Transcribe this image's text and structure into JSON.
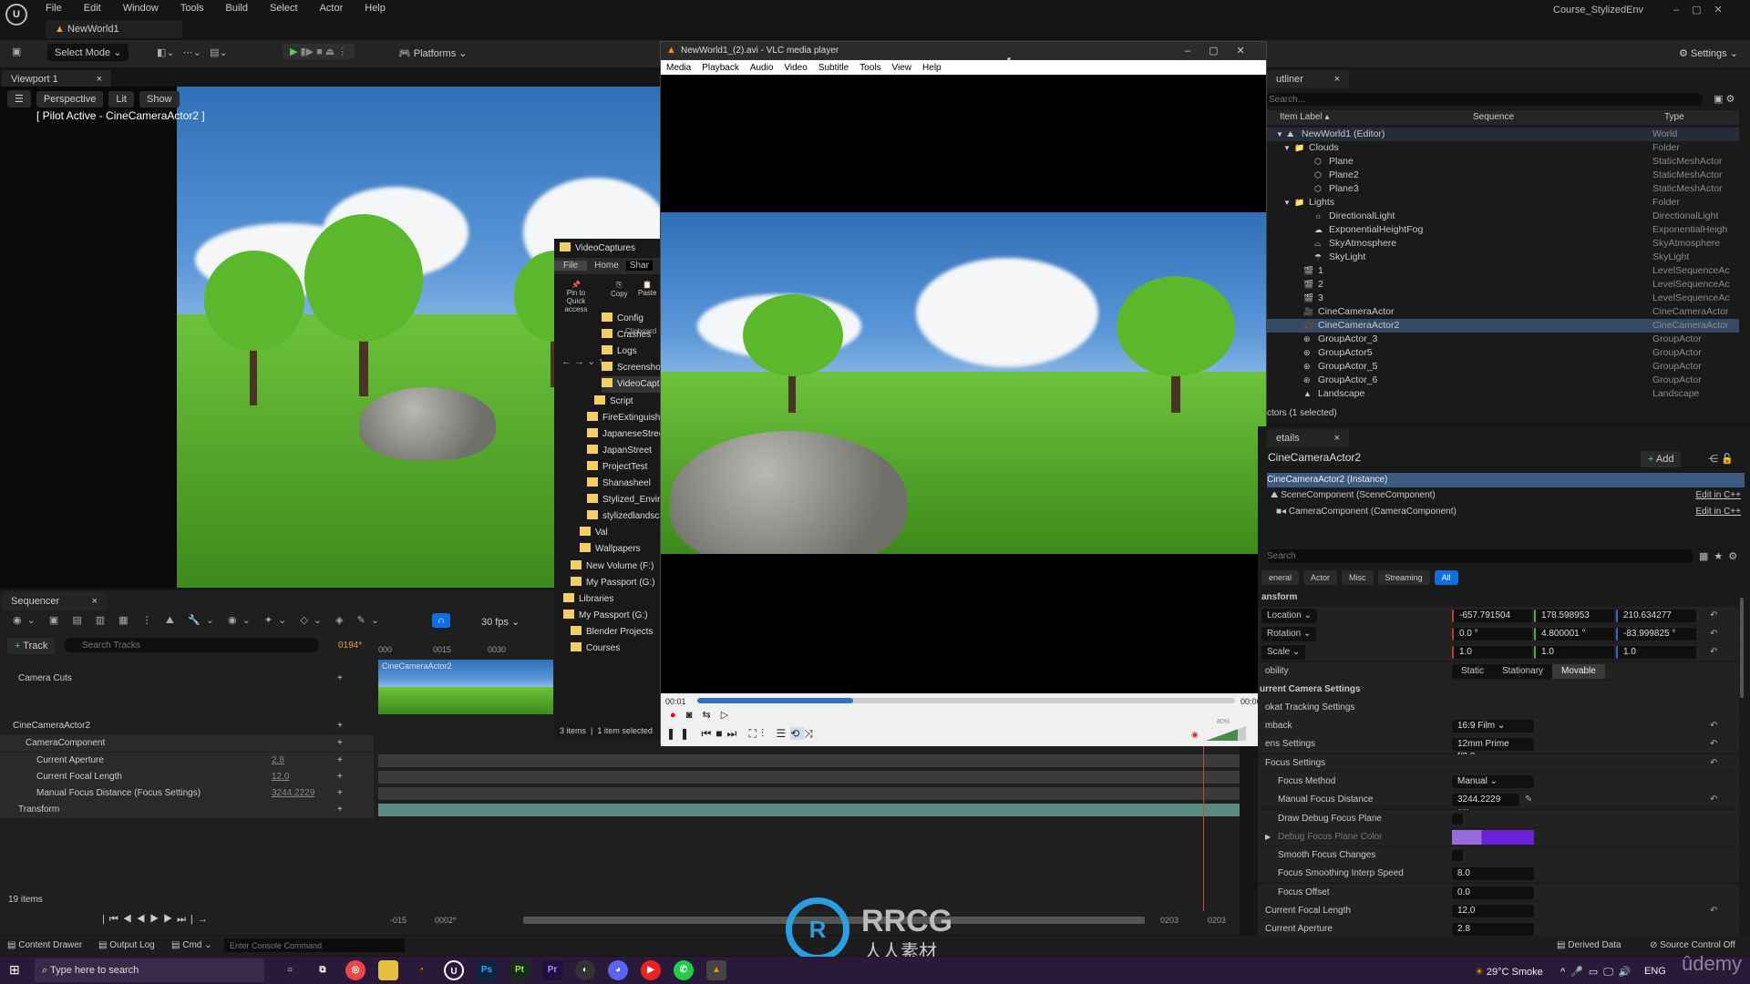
{
  "app": {
    "menu": [
      "File",
      "Edit",
      "Window",
      "Tools",
      "Build",
      "Select",
      "Actor",
      "Help"
    ],
    "level_tab": "NewWorld1",
    "project": "Course_StylizedEnv",
    "settings": "Settings"
  },
  "toolbar": {
    "select_mode": "Select Mode",
    "platforms": "Platforms"
  },
  "viewport": {
    "tab": "Viewport 1",
    "perspective": "Perspective",
    "lit": "Lit",
    "show": "Show",
    "pilot": "[ Pilot Active - CineCameraActor2 ]"
  },
  "sequencer": {
    "tab": "Sequencer",
    "fps": "30 fps",
    "track_btn": "Track",
    "search_placeholder": "Search Tracks",
    "frame": "0194*",
    "ticks": [
      "000",
      "0015",
      "0030"
    ],
    "clip": "CineCameraActor2",
    "rows": [
      {
        "label": "Camera Cuts"
      },
      {
        "label": "CineCameraActor2"
      },
      {
        "label": "CameraComponent"
      },
      {
        "label": "Current Aperture",
        "value": "2.8"
      },
      {
        "label": "Current Focal Length",
        "value": "12.0"
      },
      {
        "label": "Manual Focus Distance (Focus Settings)",
        "value": "3244.2229"
      },
      {
        "label": "Transform"
      }
    ],
    "items": "19 items",
    "range_start": "-015",
    "range_in": "0002*",
    "range_out": "0203",
    "range_end": "0203"
  },
  "explorer": {
    "title": "VideoCaptures",
    "tabs": [
      "File",
      "Home",
      "Shar"
    ],
    "ribbon": [
      "Pin to Quick access",
      "Copy",
      "Paste"
    ],
    "group": "Clipboard",
    "folders": [
      "Config",
      "Crashes",
      "Logs",
      "Screenshots",
      "VideoCaptu",
      "Script",
      "FireExtinguish",
      "JapaneseStreet",
      "JapanStreet",
      "ProjectTest",
      "Shanasheel",
      "Stylized_Enviro",
      "stylizedlandsca",
      "Val",
      "Wallpapers",
      "New Volume (F:)",
      "My Passport (G:)",
      "Libraries",
      "My Passport (G:)",
      "Blender Projects",
      "Courses"
    ],
    "status": "3 items  |  1 item selected"
  },
  "vlc": {
    "title": "NewWorld1_(2).avi - VLC media player",
    "menu": [
      "Media",
      "Playback",
      "Audio",
      "Video",
      "Subtitle",
      "Tools",
      "View",
      "Help"
    ],
    "elapsed": "00:01",
    "total": "00:06",
    "progress": 0.29,
    "volume": "80%",
    "volume_level": 0.8
  },
  "outliner": {
    "tab": "utliner",
    "search_placeholder": "Search...",
    "col_label": "Item Label",
    "col_seq": "Sequence",
    "col_type": "Type",
    "rows": [
      {
        "label": "NewWorld1 (Editor)",
        "type": "World",
        "depth": 0,
        "icon": "world-icon"
      },
      {
        "label": "Clouds",
        "type": "Folder",
        "depth": 1,
        "icon": "folder-icon"
      },
      {
        "label": "Plane",
        "type": "StaticMeshActor",
        "depth": 2,
        "icon": "mesh-icon"
      },
      {
        "label": "Plane2",
        "type": "StaticMeshActor",
        "depth": 2,
        "icon": "mesh-icon"
      },
      {
        "label": "Plane3",
        "type": "StaticMeshActor",
        "depth": 2,
        "icon": "mesh-icon"
      },
      {
        "label": "Lights",
        "type": "Folder",
        "depth": 1,
        "icon": "folder-icon"
      },
      {
        "label": "DirectionalLight",
        "type": "DirectionalLight",
        "depth": 2,
        "icon": "light-icon"
      },
      {
        "label": "ExponentialHeightFog",
        "type": "ExponentialHeigh",
        "depth": 2,
        "icon": "fog-icon"
      },
      {
        "label": "SkyAtmosphere",
        "type": "SkyAtmosphere",
        "depth": 2,
        "icon": "sky-icon"
      },
      {
        "label": "SkyLight",
        "type": "SkyLight",
        "depth": 2,
        "icon": "skylight-icon"
      },
      {
        "label": "1",
        "type": "LevelSequenceAc",
        "depth": 1,
        "icon": "clapper-icon"
      },
      {
        "label": "2",
        "type": "LevelSequenceAc",
        "depth": 1,
        "icon": "clapper-icon"
      },
      {
        "label": "3",
        "type": "LevelSequenceAc",
        "depth": 1,
        "icon": "clapper-icon"
      },
      {
        "label": "CineCameraActor",
        "type": "CineCameraActor",
        "depth": 1,
        "icon": "camera-icon"
      },
      {
        "label": "CineCameraActor2",
        "type": "CineCameraActor",
        "depth": 1,
        "icon": "camera-icon",
        "selected": true
      },
      {
        "label": "GroupActor_3",
        "type": "GroupActor",
        "depth": 1,
        "icon": "group-icon"
      },
      {
        "label": "GroupActor5",
        "type": "GroupActor",
        "depth": 1,
        "icon": "group-icon"
      },
      {
        "label": "GroupActor_5",
        "type": "GroupActor",
        "depth": 1,
        "icon": "group-icon"
      },
      {
        "label": "GroupActor_6",
        "type": "GroupActor",
        "depth": 1,
        "icon": "group-icon"
      },
      {
        "label": "Landscape",
        "type": "Landscape",
        "depth": 1,
        "icon": "landscape-icon"
      }
    ],
    "status": "ctors (1 selected)"
  },
  "details": {
    "tab": "etails",
    "actor": "CineCameraActor2",
    "add": "Add",
    "instance": "CineCameraActor2 (Instance)",
    "components": [
      {
        "label": "SceneComponent (SceneComponent)",
        "link": "Edit in C++"
      },
      {
        "label": "CameraComponent (CameraComponent)",
        "link": "Edit in C++"
      }
    ],
    "search_placeholder": "Search",
    "filters": [
      "eneral",
      "Actor",
      "Misc",
      "Streaming",
      "All"
    ],
    "section": "ansform",
    "location": {
      "label": "Location",
      "x": "-657.791504",
      "y": "178.598953",
      "z": "210.634277"
    },
    "rotation": {
      "label": "Rotation",
      "x": "0.0 °",
      "y": "4.800001 °",
      "z": "-83.999825 °"
    },
    "scale": {
      "label": "Scale",
      "x": "1.0",
      "y": "1.0",
      "z": "1.0"
    },
    "mobility": {
      "label": "obility",
      "options": [
        "Static",
        "Stationary",
        "Movable"
      ],
      "selected": "Movable"
    },
    "camera_section": "urrent Camera Settings",
    "lookat": "okat Tracking Settings",
    "props": [
      {
        "label": "mback",
        "value": "16:9 Film",
        "dropdown": true
      },
      {
        "label": "ens Settings",
        "value": "12mm Prime f/2.8",
        "dropdown": true
      },
      {
        "label": "Focus Settings"
      },
      {
        "label": "Focus Method",
        "value": "Manual",
        "dropdown": true,
        "indent": true
      },
      {
        "label": "Manual Focus Distance",
        "value": "3244.2229 cm",
        "indent": true
      },
      {
        "label": "Draw Debug Focus Plane",
        "checkbox": true,
        "indent": true
      },
      {
        "label": "Debug Focus Plane Color",
        "color": "#6a1fd8",
        "indent": true
      },
      {
        "label": "Smooth Focus Changes",
        "checkbox": true,
        "indent": true
      },
      {
        "label": "Focus Smoothing Interp Speed",
        "value": "8.0",
        "indent": true
      },
      {
        "label": "Focus Offset",
        "value": "0.0",
        "indent": true
      },
      {
        "label": "Current Focal Length",
        "value": "12.0"
      },
      {
        "label": "Current Aperture",
        "value": "2.8"
      }
    ]
  },
  "statusbar": {
    "content_drawer": "Content Drawer",
    "output_log": "Output Log",
    "cmd": "Cmd",
    "console_placeholder": "Enter Console Command",
    "derived": "Derived Data",
    "source": "Source Control Off"
  },
  "taskbar": {
    "search": "Type here to search",
    "weather": "29°C  Smoke",
    "lang": "ENG",
    "apps": [
      "Ps",
      "Pt",
      "Pr"
    ]
  },
  "watermark": {
    "brand": "RRCG",
    "sub": "人人素材",
    "udemy": "ûdemy"
  },
  "colors": {
    "accent": "#0e6fe0",
    "selection": "#364a66",
    "taskbar": "#2a1a3a"
  }
}
